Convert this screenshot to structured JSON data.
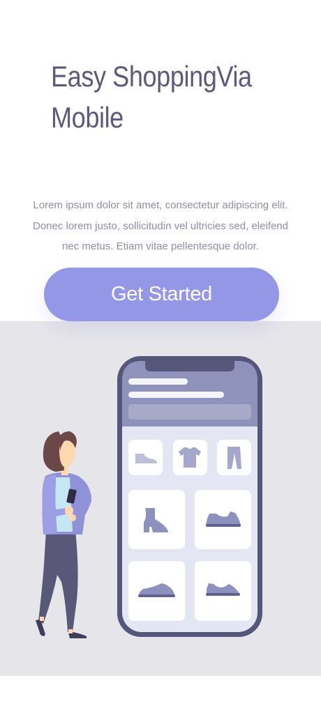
{
  "hero": {
    "title": "Easy ShoppingVia Mobile",
    "description": "Lorem ipsum dolor sit amet, consectetur adipiscing elit. Donec lorem justo, sollicitudin vel ultricies sed, eleifend nec metus. Etiam vitae pellentesque dolor.",
    "cta_label": "Get Started"
  },
  "illustration": {
    "background_color": "#e6e5ea",
    "phone_frame_color": "#56557a",
    "phone_header_color": "#8f92ba",
    "phone_screen_color": "#e4e6f4",
    "product_color": "#8e91bd",
    "accent_color": "#9497e6",
    "categories": [
      "shoe-icon",
      "tshirt-icon",
      "pants-icon"
    ],
    "products": [
      "boot-icon",
      "sneaker-icon",
      "sneaker-icon",
      "sneaker-icon"
    ]
  }
}
